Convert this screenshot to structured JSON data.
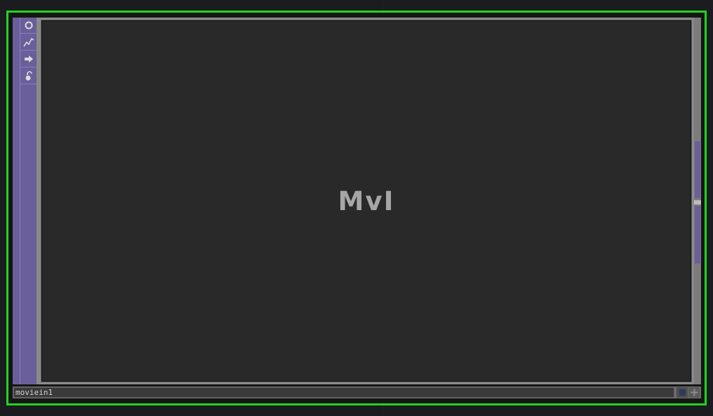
{
  "node": {
    "name": "moviein1",
    "op_label": "MvI",
    "op_type": "moviefilein",
    "border_color": "#1ed61e",
    "accent_color": "#6a5f9a"
  },
  "left_icons": [
    {
      "name": "circle-icon"
    },
    {
      "name": "wave-icon"
    },
    {
      "name": "arrow-right-icon"
    },
    {
      "name": "lock-icon"
    }
  ],
  "bottom_bar": {
    "display_flag": "viewer-display-icon",
    "expand_flag": "plus-icon"
  }
}
